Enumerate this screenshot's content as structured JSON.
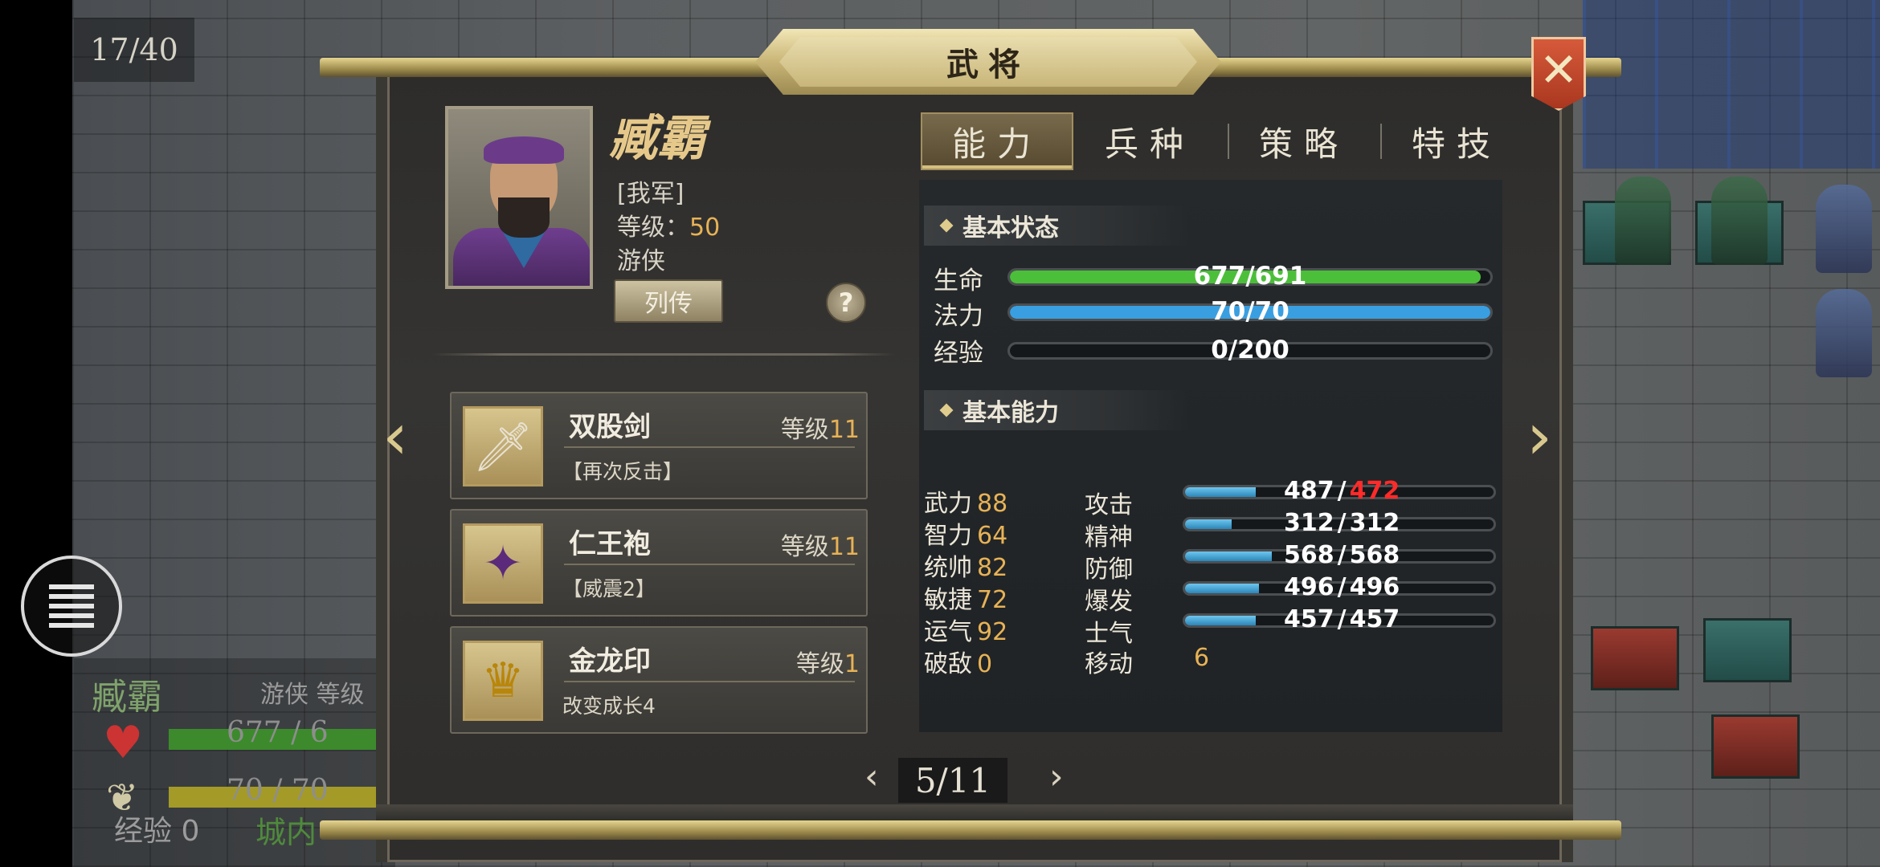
{
  "turn_counter": "17/40",
  "dialog": {
    "title": "武将",
    "close_icon": "close-x-icon"
  },
  "hero": {
    "name": "臧霸",
    "faction": "[我军]",
    "level_label": "等级：",
    "level": "50",
    "class": "游侠",
    "biography_button": "列传",
    "help_button": "?"
  },
  "equipment": [
    {
      "name": "双股剑",
      "level_label": "等级",
      "level": "11",
      "effect": "【再次反击】",
      "icon": "sword-icon"
    },
    {
      "name": "仁王袍",
      "level_label": "等级",
      "level": "11",
      "effect": "【威震2】",
      "icon": "robe-icon"
    },
    {
      "name": "金龙印",
      "level_label": "等级",
      "level": "1",
      "effect": "改变成长4",
      "icon": "golden-seal-icon"
    }
  ],
  "tabs": [
    {
      "label": "能力",
      "active": true
    },
    {
      "label": "兵种",
      "active": false
    },
    {
      "label": "策略",
      "active": false
    },
    {
      "label": "特技",
      "active": false
    }
  ],
  "basic_status": {
    "title": "基本状态",
    "rows": [
      {
        "label": "生命",
        "text": "677/691",
        "fill": 0.98,
        "color": "#4cbf3a"
      },
      {
        "label": "法力",
        "text": "70/70",
        "fill": 1.0,
        "color": "#3a9fe0"
      },
      {
        "label": "经验",
        "text": "0/200",
        "fill": 0.0,
        "color": "#e0c53a"
      }
    ]
  },
  "basic_ability": {
    "title": "基本能力",
    "attributes": [
      {
        "label": "武力",
        "value": "88"
      },
      {
        "label": "智力",
        "value": "64"
      },
      {
        "label": "统帅",
        "value": "82"
      },
      {
        "label": "敏捷",
        "value": "72"
      },
      {
        "label": "运气",
        "value": "92"
      },
      {
        "label": "破敌",
        "value": "0"
      }
    ],
    "derived": [
      {
        "label": "攻击",
        "current": "487",
        "modified": "472",
        "modified_color": "#ff2a2a",
        "fill": 0.23
      },
      {
        "label": "精神",
        "current": "312",
        "modified": "312",
        "fill": 0.15
      },
      {
        "label": "防御",
        "current": "568",
        "modified": "568",
        "fill": 0.28
      },
      {
        "label": "爆发",
        "current": "496",
        "modified": "496",
        "fill": 0.24
      },
      {
        "label": "士气",
        "current": "457",
        "modified": "457",
        "fill": 0.23
      }
    ],
    "move_label": "移动",
    "move_value": "6"
  },
  "pager": {
    "current": "5/11"
  },
  "unit_status": {
    "name": "臧霸",
    "class": "游侠 等级",
    "hp_text": "677 / 6",
    "mp_text": "70 / 70",
    "exp_label": "经验",
    "exp_value": "0",
    "location": "城内"
  },
  "colors": {
    "gold": "#e7b256",
    "accent_tab": "#56492f",
    "bar_blue": "#2b86b8"
  }
}
